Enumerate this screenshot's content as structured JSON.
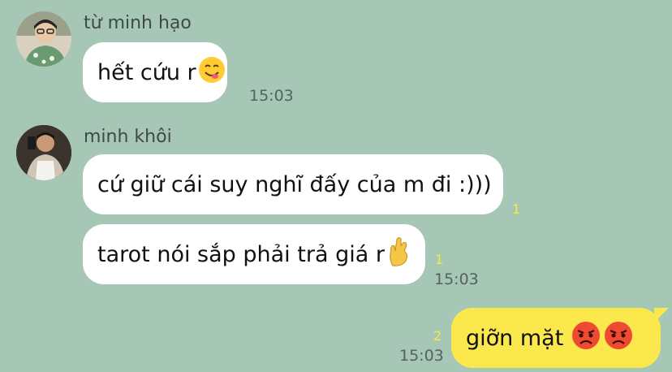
{
  "messages": [
    {
      "sender": "từ minh hạo",
      "text": "hết cứu r",
      "emoji": "yum-face-icon",
      "time": "15:03"
    },
    {
      "sender": "minh khôi",
      "text": "cứ giữ cái suy nghĩ đấy của m đi :)))",
      "unread": "1"
    },
    {
      "text": "tarot nói sắp phải trả giá r",
      "emoji": "crossed-fingers-icon",
      "unread": "1",
      "time": "15:03"
    },
    {
      "text": "giỡn mặt",
      "emoji": "angry-face-icon",
      "unread": "2",
      "time": "15:03",
      "mine": true
    }
  ],
  "colors": {
    "background": "#a6c6b6",
    "bubble_incoming": "#ffffff",
    "bubble_outgoing": "#fbe84c",
    "unread_count": "#f5ef3a"
  }
}
